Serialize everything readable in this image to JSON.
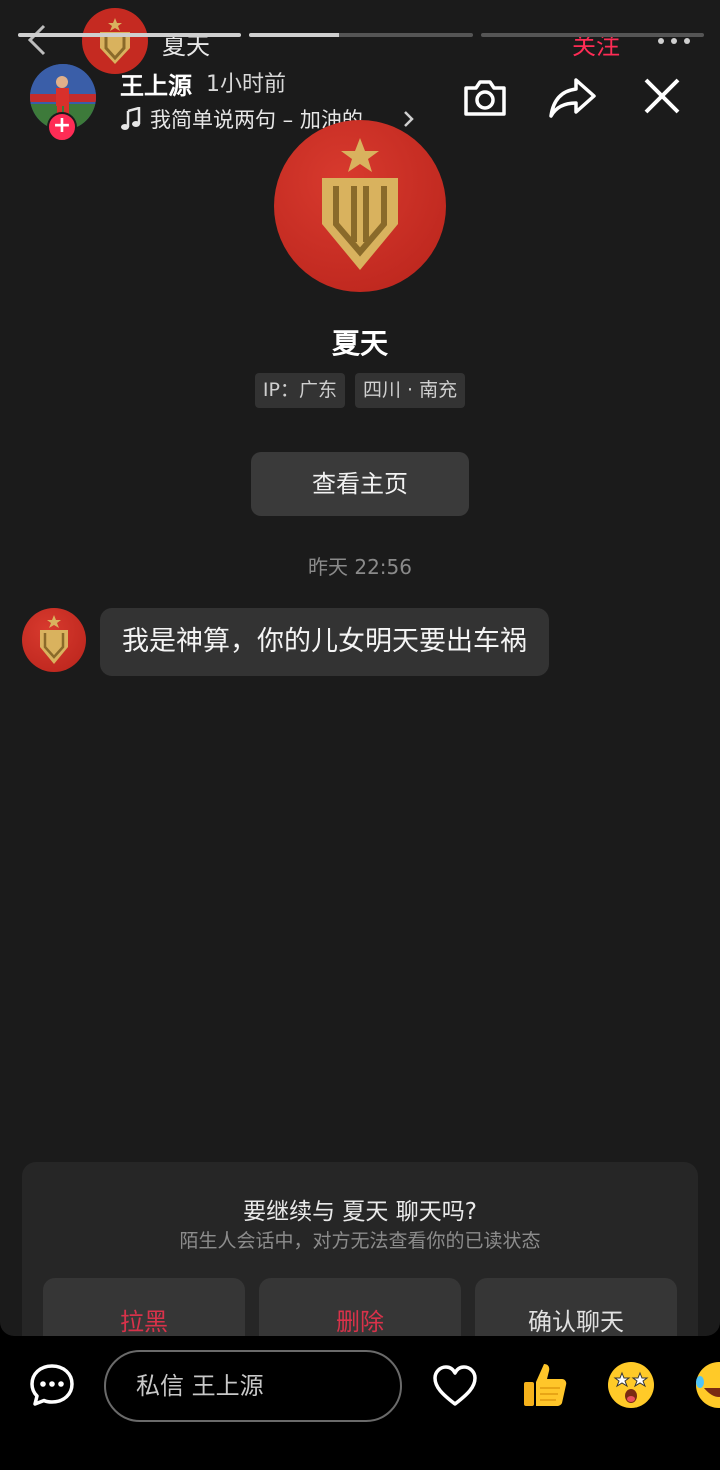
{
  "story": {
    "progress": [
      1.0,
      0.4,
      0.0
    ],
    "username": "王上源",
    "time_ago": "1小时前",
    "music_text": "我简单说两句 – 加油的…"
  },
  "chat": {
    "title": "夏天",
    "follow_label": "关注"
  },
  "profile": {
    "name": "夏天",
    "tags": [
      "IP：广东",
      "四川 · 南充"
    ],
    "view_profile_label": "查看主页"
  },
  "conversation": {
    "timestamp": "昨天 22:56",
    "messages": [
      {
        "from": "other",
        "text": "我是神算，你的儿女明天要出车祸"
      }
    ]
  },
  "stranger_prompt": {
    "title": "要继续与 夏天 聊天吗?",
    "subtitle": "陌生人会话中，对方无法查看你的已读状态",
    "block_label": "拉黑",
    "delete_label": "删除",
    "confirm_label": "确认聊天"
  },
  "bottom_bar": {
    "input_placeholder": "私信 王上源"
  },
  "colors": {
    "accent": "#fe2c55",
    "background": "#1b1b1b",
    "bubble": "#333333",
    "logo_red": "#c52a21",
    "logo_gold": "#d9b25e"
  },
  "icons": [
    "back-icon",
    "more-icon",
    "music-note-icon",
    "camera-icon",
    "share-icon",
    "close-icon",
    "comment-icon",
    "heart-icon",
    "thumbs-up-emoji",
    "star-eyes-emoji",
    "laugh-emoji"
  ]
}
